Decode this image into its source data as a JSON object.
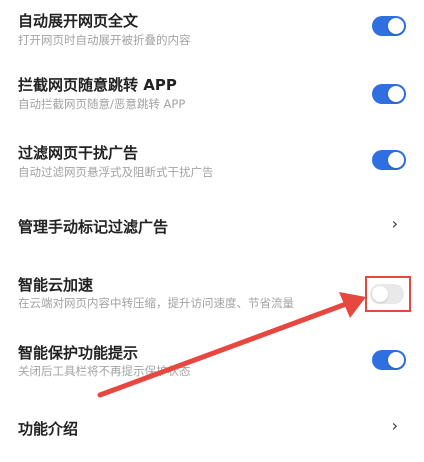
{
  "settings": [
    {
      "title": "自动展开网页全文",
      "subtitle": "打开网页时自动展开被折叠的内容",
      "control": "toggle",
      "enabled": true
    },
    {
      "title": "拦截网页随意跳转 APP",
      "subtitle": "自动拦截网页随意/恶意跳转 APP",
      "control": "toggle",
      "enabled": true
    },
    {
      "title": "过滤网页干扰广告",
      "subtitle": "自动过滤网页悬浮式及阻断式干扰广告",
      "control": "toggle",
      "enabled": true
    },
    {
      "title": "管理手动标记过滤广告",
      "control": "chevron",
      "chevron": "›"
    },
    {
      "title": "智能云加速",
      "subtitle": "在云端对网页内容中转压缩，提升访问速度、节省流量",
      "control": "toggle",
      "enabled": false
    },
    {
      "title": "智能保护功能提示",
      "subtitle": "关闭后工具栏将不再提示保护状态",
      "control": "toggle",
      "enabled": true
    },
    {
      "title": "功能介绍",
      "control": "chevron",
      "chevron": "›"
    }
  ],
  "colors": {
    "toggle_on": "#2f6fe0",
    "toggle_off": "#e9e9e9",
    "annotation": "#e8473f"
  }
}
